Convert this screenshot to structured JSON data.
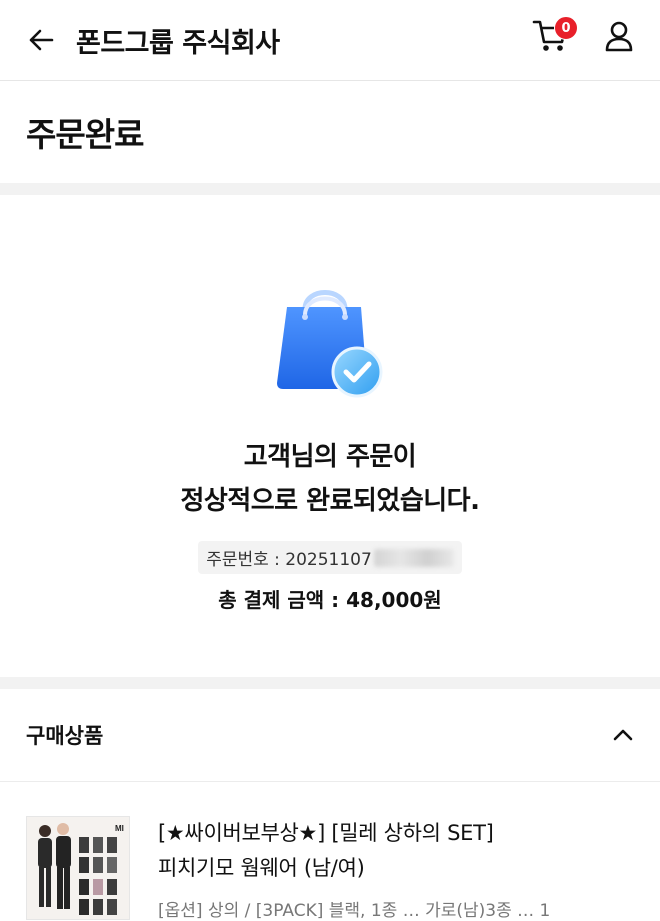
{
  "header": {
    "store_name": "폰드그룹 주식회사",
    "cart_count": "0"
  },
  "page": {
    "title": "주문완료"
  },
  "completion": {
    "message_line1": "고객님의 주문이",
    "message_line2": "정상적으로 완료되었습니다.",
    "order_number_label": "주문번호 : 20251107",
    "total_label": "총 결제 금액 : 48,000원"
  },
  "purchased": {
    "section_title": "구매상품",
    "product": {
      "name_line1": "[★싸이버보부상★] [밀레 상하의 SET]",
      "name_line2": "피치기모 웜웨어 (남/여)",
      "option_partial": "[옵션] 상의 / [3PACK] 블랙, 1종 … 가로(남)3종 … 1"
    }
  },
  "colors": {
    "accent_red": "#e8202a",
    "bag_blue": "#2f7df6",
    "check_blue": "#43a9f5"
  }
}
